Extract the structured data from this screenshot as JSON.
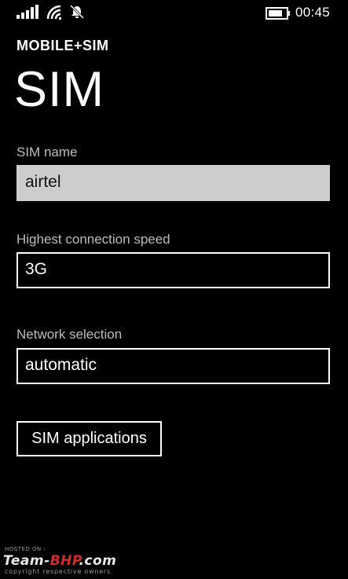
{
  "status_bar": {
    "time": "00:45",
    "icons": [
      "signal-icon",
      "wifi-icon",
      "quiet-hours-icon",
      "battery-icon"
    ]
  },
  "header": {
    "app_title": "MOBILE+SIM",
    "page_title": "SIM"
  },
  "fields": {
    "sim_name": {
      "label": "SIM name",
      "value": "airtel"
    },
    "connection_speed": {
      "label": "Highest connection speed",
      "value": "3G"
    },
    "network_selection": {
      "label": "Network selection",
      "value": "automatic"
    }
  },
  "buttons": {
    "sim_applications": "SIM applications"
  },
  "watermark": {
    "hosted": "HOSTED ON :",
    "logo_prefix": "Team-",
    "logo_highlight": "BHP",
    "logo_suffix": ".com",
    "copyright": "copyright respective owners"
  },
  "colors": {
    "background": "#000000",
    "text": "#ffffff",
    "label": "#bdbdbd",
    "filled_field": "#cdcdcd",
    "watermark_accent": "#d32a2a"
  }
}
